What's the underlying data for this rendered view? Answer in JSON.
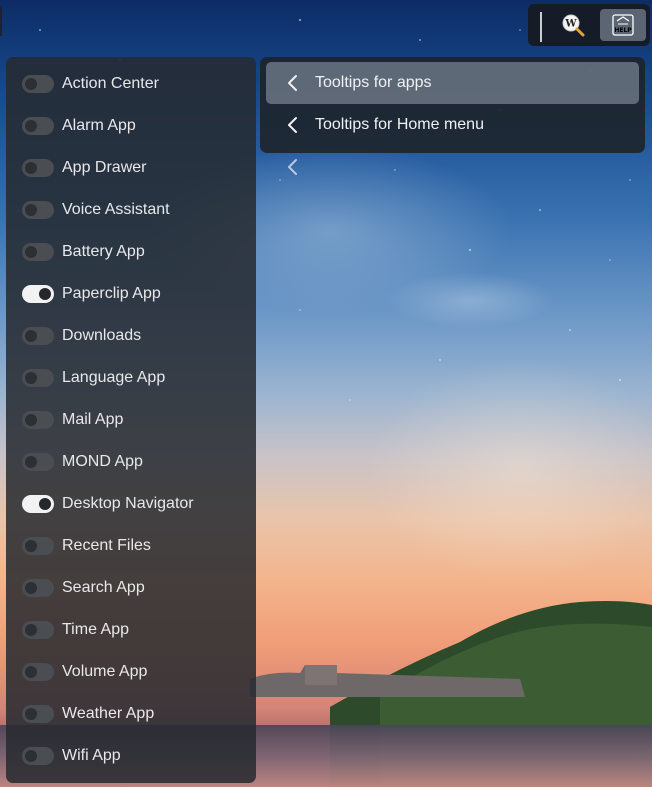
{
  "toggles": [
    {
      "label": "Action Center",
      "on": false
    },
    {
      "label": "Alarm App",
      "on": false
    },
    {
      "label": "App Drawer",
      "on": false
    },
    {
      "label": "Voice Assistant",
      "on": false
    },
    {
      "label": "Battery App",
      "on": false
    },
    {
      "label": "Paperclip App",
      "on": true
    },
    {
      "label": "Downloads",
      "on": false
    },
    {
      "label": "Language App",
      "on": false
    },
    {
      "label": "Mail App",
      "on": false
    },
    {
      "label": "MOND App",
      "on": false
    },
    {
      "label": "Desktop Navigator",
      "on": true
    },
    {
      "label": "Recent Files",
      "on": false
    },
    {
      "label": "Search App",
      "on": false
    },
    {
      "label": "Time App",
      "on": false
    },
    {
      "label": "Volume App",
      "on": false
    },
    {
      "label": "Weather App",
      "on": false
    },
    {
      "label": "Wifi App",
      "on": false
    }
  ],
  "submenu": {
    "items": [
      {
        "label": "Tooltips for apps",
        "active": true
      },
      {
        "label": "Tooltips for Home menu",
        "active": false
      }
    ]
  },
  "toolbar": {
    "wiki_icon": "wiki-search-icon",
    "help_icon": "help-icon",
    "help_text": "HELP"
  }
}
